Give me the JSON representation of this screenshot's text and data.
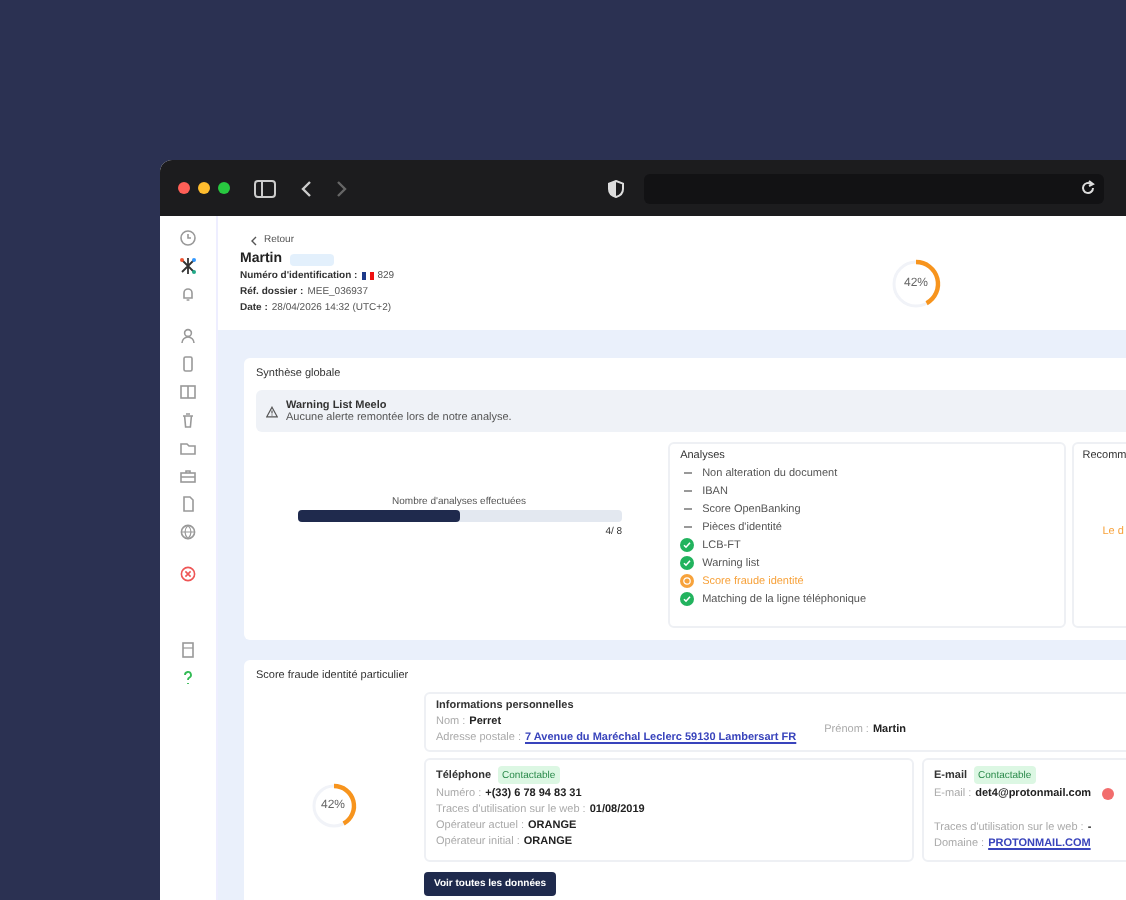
{
  "header": {
    "back": "Retour",
    "name": "Martin",
    "id_label": "Numéro d'identification :",
    "id_value": "829",
    "ref_label": "Réf. dossier :",
    "ref_value": "MEE_036937",
    "date_label": "Date :",
    "date_value": "28/04/2026 14:32 (UTC+2)",
    "score": "42%",
    "level": 0.42
  },
  "synthesis": {
    "title": "Synthèse globale",
    "warning": {
      "title": "Warning List Meelo",
      "text": "Aucune alerte remontée lors de notre analyse."
    },
    "progress": {
      "label": "Nombre d'analyses effectuées",
      "level": 0.5,
      "reading": "4/ 8"
    },
    "analyses": {
      "title": "Analyses",
      "items": [
        {
          "label": "Non alteration du document",
          "kind": "pending"
        },
        {
          "label": "IBAN",
          "kind": "pending"
        },
        {
          "label": "Score OpenBanking",
          "kind": "pending"
        },
        {
          "label": "Pièces d'identité",
          "kind": "pending"
        },
        {
          "label": "LCB-FT",
          "kind": "ok"
        },
        {
          "label": "Warning list",
          "kind": "ok"
        },
        {
          "label": "Score fraude identité",
          "kind": "warning"
        },
        {
          "label": "Matching de la ligne téléphonique",
          "kind": "ok"
        }
      ]
    },
    "recommendation": {
      "title": "Recomm",
      "text": "Le d"
    }
  },
  "fraud": {
    "title": "Score fraude identité particulier",
    "score": "42%",
    "level": 0.42,
    "personal": {
      "title": "Informations personnelles",
      "fields": [
        {
          "label": "Nom :",
          "value": "Perret",
          "kind": "text"
        },
        {
          "label": "Adresse postale :",
          "value": "7 Avenue du Maréchal Leclerc 59130 Lambersart FR",
          "kind": "link"
        }
      ],
      "side": {
        "label": "Prénom :",
        "value": "Martin"
      }
    },
    "phone": {
      "title": "Téléphone",
      "badge": "Contactable",
      "fields": [
        {
          "label": "Numéro :",
          "value": "+(33) 6 78 94 83 31",
          "kind": "text"
        },
        {
          "label": "Traces d'utilisation sur le web :",
          "value": "01/08/2019",
          "kind": "text"
        },
        {
          "label": "Opérateur actuel :",
          "value": "ORANGE",
          "kind": "text"
        },
        {
          "label": "Opérateur initial :",
          "value": "ORANGE",
          "kind": "text"
        }
      ]
    },
    "email": {
      "title": "E-mail",
      "badge": "Contactable",
      "fields": [
        {
          "label": "E-mail :",
          "value": "det4@protonmail.com",
          "kind": "text"
        },
        {
          "label": "Traces d'utilisation sur le web :",
          "value": "-",
          "kind": "text"
        },
        {
          "label": "Domaine :",
          "value": "PROTONMAIL.COM",
          "kind": "link"
        }
      ]
    },
    "button": "Voir toutes les données"
  }
}
